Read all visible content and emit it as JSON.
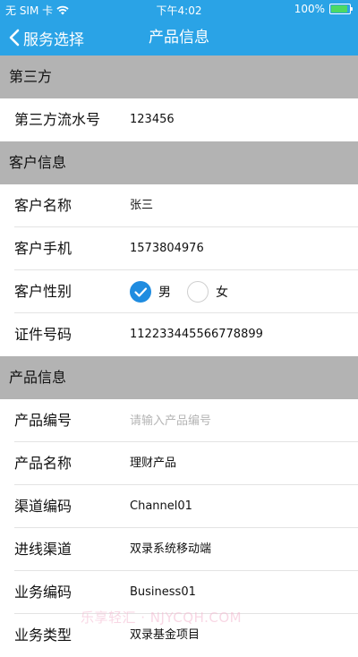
{
  "status_bar": {
    "carrier": "无 SIM 卡",
    "time": "下午4:02",
    "battery": "100%",
    "battery_level": 1.0
  },
  "nav": {
    "back_label": "服务选择",
    "title": "产品信息"
  },
  "sections": {
    "third_party": {
      "header": "第三方",
      "serial_label": "第三方流水号",
      "serial_value": "123456"
    },
    "customer": {
      "header": "客户信息",
      "name_label": "客户名称",
      "name_value": "张三",
      "phone_label": "客户手机",
      "phone_value": "1573804976",
      "gender_label": "客户性别",
      "gender_male": "男",
      "gender_female": "女",
      "gender_selected": "男",
      "id_label": "证件号码",
      "id_value": "112233445566778899"
    },
    "product": {
      "header": "产品信息",
      "code_label": "产品编号",
      "code_placeholder": "请输入产品编号",
      "name_label": "产品名称",
      "name_value": "理财产品",
      "channel_code_label": "渠道编码",
      "channel_code_value": "Channel01",
      "entry_channel_label": "进线渠道",
      "entry_channel_value": "双录系统移动端",
      "business_code_label": "业务编码",
      "business_code_value": "Business01",
      "business_type_label": "业务类型",
      "business_type_value": "双录基金项目"
    }
  },
  "watermark": "乐享轻汇 · NJYCQH.COM",
  "colors": {
    "accent": "#2aa3e6",
    "section_bg": "#b3b3b3",
    "radio_checked": "#1f8ce0"
  }
}
